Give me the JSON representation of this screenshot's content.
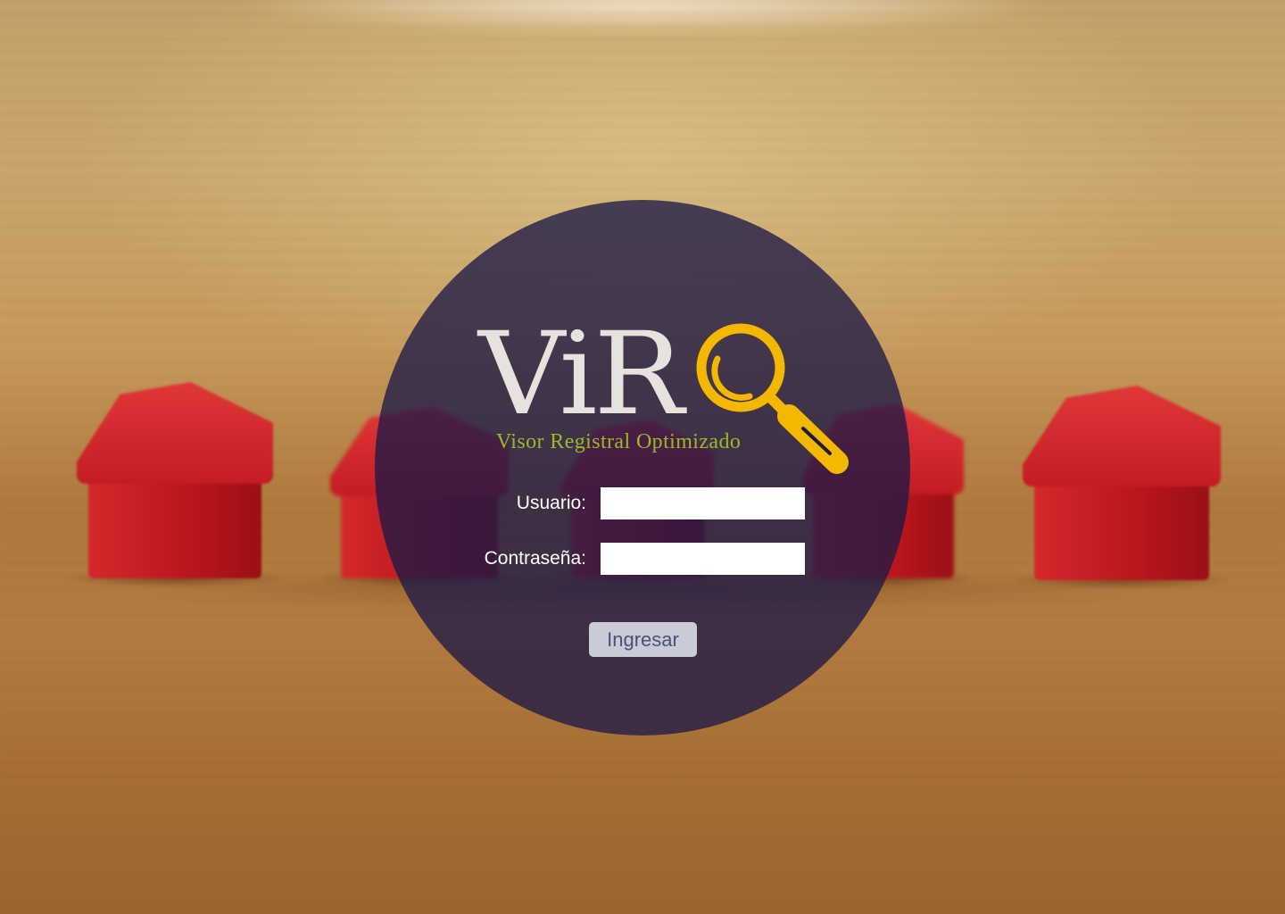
{
  "app": {
    "logo_text": "ViR",
    "logo_subtitle": "Visor Registral Optimizado",
    "logo_icon": "magnifier-icon"
  },
  "login": {
    "username_label": "Usuario:",
    "username_value": "",
    "password_label": "Contraseña:",
    "password_value": "",
    "submit_label": "Ingresar"
  },
  "colors": {
    "overlay_circle": "#1e1946",
    "logo_text": "#e6e2de",
    "logo_subtitle": "#9ab82a",
    "magnifier": "#f5b800",
    "button_bg": "#c9ccd6",
    "button_text": "#47527a"
  }
}
